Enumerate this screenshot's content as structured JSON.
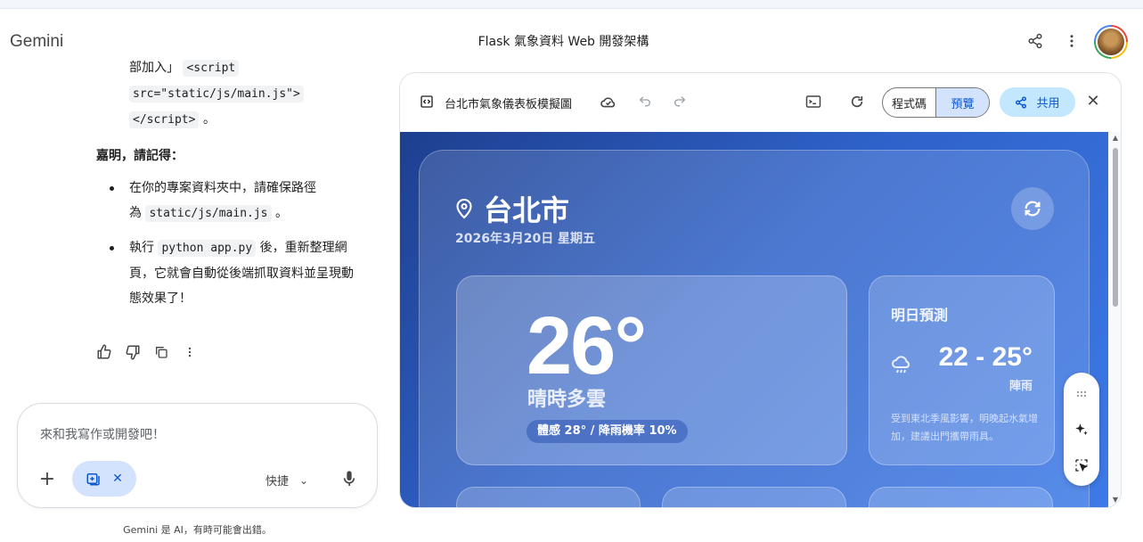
{
  "app": {
    "brand": "Gemini",
    "conversation_title": "Flask 氣象資料 Web 開發架構"
  },
  "chat": {
    "line0_prefix": "部加入」",
    "line0_code": "<script",
    "code_line1": "src=\"static/js/main.js\">",
    "code_line2": "</script>",
    "code_line2_suffix": "。",
    "reminder": "嘉明，請記得：",
    "bullet1_a": "在你的專案資料夾中，請確保路徑",
    "bullet1_b": "為",
    "bullet1_code": "static/js/main.js",
    "bullet1_c": "。",
    "bullet2_a": "執行",
    "bullet2_code": "python app.py",
    "bullet2_b": "後，重新整理網頁，它就會自動從後端抓取資料並呈現動態效果了！"
  },
  "input": {
    "placeholder": "來和我寫作或開發吧！",
    "mode": "快捷"
  },
  "disclaimer": "Gemini 是 AI，有時可能會出錯。",
  "canvas": {
    "title": "台北市氣象儀表板模擬圖",
    "tab_code": "程式碼",
    "tab_preview": "預覽",
    "share": "共用"
  },
  "weather": {
    "city": "台北市",
    "date": "2026年3月20日 星期五",
    "temp": "26°",
    "condition": "晴時多雲",
    "feel": "體感 28° / 降雨機率 10%",
    "forecast_title": "明日預測",
    "forecast_range": "22 - 25°",
    "forecast_cond": "陣雨",
    "forecast_note": "受到東北季風影響，明晚起水氣增加，建議出門攜帶雨具。"
  },
  "colors": {
    "accent": "#0b57d0",
    "chip": "#d3e3fd",
    "share": "#c2e7ff",
    "weather_bg_start": "#1e3f8f",
    "weather_bg_end": "#3d7ae8"
  }
}
